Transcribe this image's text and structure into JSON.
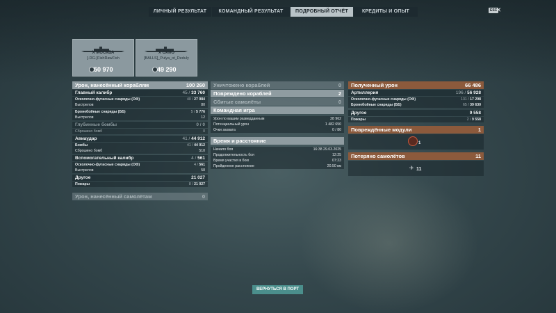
{
  "tabs": [
    {
      "label": "ЛИЧНЫЙ РЕЗУЛЬТАТ",
      "active": false
    },
    {
      "label": "КОМАНДНЫЙ РЕЗУЛЬТАТ",
      "active": false
    },
    {
      "label": "ПОДРОБНЫЙ ОТЧЁТ",
      "active": true
    },
    {
      "label": "КРЕДИТЫ И ОПЫТ",
      "active": false
    }
  ],
  "esc_label": "ESC",
  "close_symbol": "×",
  "ships": [
    {
      "name": "X МОСКВА",
      "player": "[-DG-]FishRawFish",
      "score": "50 970"
    },
    {
      "name": "X ОХИО",
      "player": "[BALLS]_Pulya_ot_Deduly",
      "score": "49 290"
    }
  ],
  "left": {
    "damage": {
      "label": "Урон, нанесённый кораблям",
      "value": "100 260"
    },
    "main": {
      "label": "Главный калибр",
      "pre": "45 / ",
      "value": "33 760"
    },
    "main_rows": [
      {
        "label": "Осколочно-фугасные снаряды (ОФ)",
        "pre": "40 / ",
        "value": "27 984",
        "gap": false
      },
      {
        "label": "Выстрелов",
        "pre": "",
        "value": "80",
        "gap": true
      },
      {
        "label": "Бронебойные снаряды (ББ)",
        "pre": "5 / ",
        "value": "5 776",
        "gap": false
      },
      {
        "label": "Выстрелов",
        "pre": "",
        "value": "12",
        "gap": false
      }
    ],
    "depth": {
      "label": "Глубинные бомбы",
      "pre": "0 / ",
      "value": "0"
    },
    "depth_row": {
      "label": "Сброшено бомб",
      "value": "0"
    },
    "air": {
      "label": "Авиаудар",
      "pre": "41 / ",
      "value": "44 912"
    },
    "air_rows": [
      {
        "label": "Бомбы",
        "pre": "41 / ",
        "value": "44 912"
      },
      {
        "label": "Сброшено бомб",
        "pre": "",
        "value": "510"
      }
    ],
    "secondary": {
      "label": "Вспомогательный калибр",
      "pre": "4 / ",
      "value": "561"
    },
    "secondary_rows": [
      {
        "label": "Осколочно-фугасные снаряды (ОФ)",
        "pre": "4 / ",
        "value": "561"
      },
      {
        "label": "Выстрелов",
        "pre": "",
        "value": "58"
      }
    ],
    "other": {
      "label": "Другое",
      "value": "21 027"
    },
    "other_row": {
      "label": "Пожары",
      "pre": "8 / ",
      "value": "21 027"
    },
    "planes_damage": {
      "label": "Урон, нанесённый самолётам",
      "value": "0"
    }
  },
  "middle": {
    "destroyed": {
      "label": "Уничтожено кораблей",
      "value": "0"
    },
    "damaged": {
      "label": "Повреждено кораблей",
      "value": "2"
    },
    "planes": {
      "label": "Сбитые самолёты",
      "value": "0"
    },
    "team": {
      "label": "Командная игра"
    },
    "team_rows": [
      {
        "label": "Урон по вашим разведданным",
        "value": "28 962"
      },
      {
        "label": "Потенциальный урон",
        "value": "1 482 650"
      },
      {
        "label": "Очки захвата",
        "value": "0 / 80"
      }
    ],
    "time": {
      "label": "Время и расстояние"
    },
    "time_rows": [
      {
        "label": "Начало боя",
        "value": "16:38  29.03.2025"
      },
      {
        "label": "Продолжительность боя",
        "value": "12:25"
      },
      {
        "label": "Время участия в бою",
        "value": "07:23"
      },
      {
        "label": "Пройденное расстояние",
        "value": "20.50 км"
      }
    ]
  },
  "right": {
    "received": {
      "label": "Полученный урон",
      "value": "66 486"
    },
    "artillery": {
      "label": "Артиллерия",
      "pre": "196 / ",
      "value": "56 928"
    },
    "art_rows": [
      {
        "label": "Осколочно-фугасные снаряды (ОФ)",
        "pre": "131 / ",
        "value": "17 298"
      },
      {
        "label": "Бронебойные снаряды (ББ)",
        "pre": "65 / ",
        "value": "39 630"
      }
    ],
    "other": {
      "label": "Другое",
      "value": "9 558"
    },
    "other_row": {
      "label": "Пожары",
      "pre": "2 / ",
      "value": "9 558"
    },
    "modules": {
      "label": "Повреждённые модули",
      "value": "1",
      "icon_count": "1"
    },
    "planes_lost": {
      "label": "Потеряно самолётов",
      "value": "11",
      "icon_count": "11"
    }
  },
  "footer": {
    "return_label": "ВЕРНУТЬСЯ В ПОРТ"
  },
  "colors": {
    "accent_orange": "#8c5a3c",
    "accent_teal": "#4b8f8c",
    "header_light": "#8f9ca1"
  }
}
